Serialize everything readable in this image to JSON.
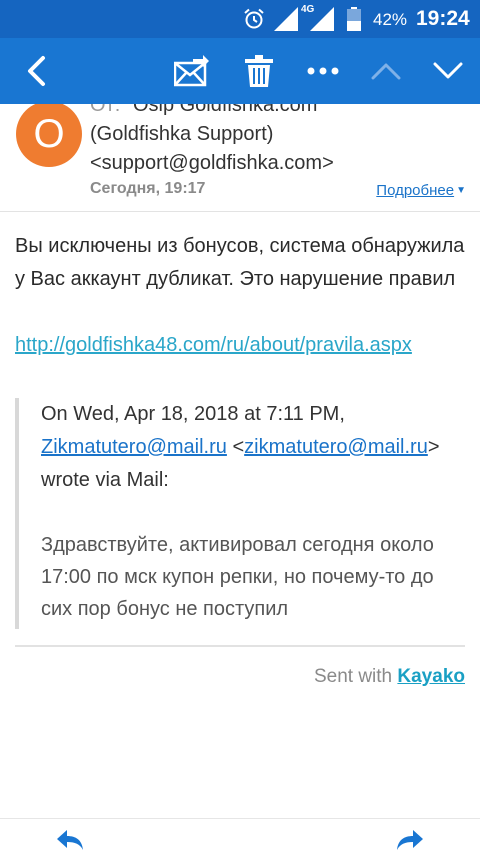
{
  "status_bar": {
    "network": "4G",
    "battery_percent": "42%",
    "time": "19:24"
  },
  "action_bar": {
    "icons": [
      "back-icon",
      "move-mail-icon",
      "delete-icon",
      "more-icon",
      "previous-icon",
      "next-icon"
    ],
    "background": "#1976d2"
  },
  "header": {
    "avatar_letter": "O",
    "avatar_color": "#ef7c30",
    "from_prefix": "От:",
    "from_name": "\"Osip Goldfishka.com",
    "from_org": "(Goldfishka Support)",
    "from_email": "<support@goldfishka.com>",
    "date": "Сегодня, 19:17",
    "details": "Подробнее"
  },
  "message": {
    "text": "Вы исключены из бонусов, система обнаружила у Вас  аккаунт дубликат. Это нарушение правил",
    "link": "http://goldfishka48.com/ru/about/pravila.aspx"
  },
  "quote": {
    "intro": "On Wed, Apr 18, 2018 at 7:11 PM,",
    "sender_link": "Zikmatutero@mail.ru",
    "lt": " <",
    "sender_email_link": "zikmatutero@mail.ru",
    "gt": ">",
    "tail": "wrote via Mail:",
    "text": "Здравствуйте, активировал сегодня около 17:00 по мск купон репки, но почему-то до сих пор бонус не поступил"
  },
  "footer": {
    "sent_with": "Sent with ",
    "brand": "Kayako"
  },
  "bottom_bar": {
    "icons": [
      "reply-icon",
      "forward-icon"
    ]
  }
}
